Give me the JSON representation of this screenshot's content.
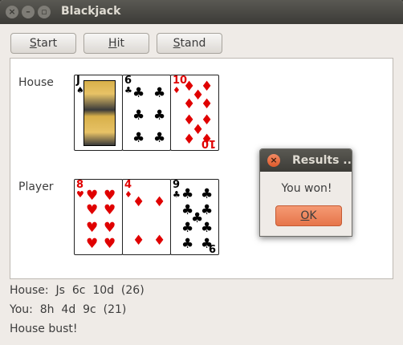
{
  "window": {
    "title": "Blackjack",
    "close_glyph": "×",
    "min_glyph": "–",
    "max_glyph": "▫"
  },
  "toolbar": {
    "start": {
      "mnemonic": "S",
      "rest": "tart"
    },
    "hit": {
      "mnemonic": "H",
      "rest": "it"
    },
    "stand": {
      "mnemonic": "S",
      "rest": "tand"
    }
  },
  "table": {
    "house_label": "House",
    "player_label": "Player",
    "house_cards": [
      {
        "rank": "J",
        "suit": "♠",
        "color": "#000000",
        "face": "jack"
      },
      {
        "rank": "6",
        "suit": "♣",
        "color": "#000000"
      },
      {
        "rank": "10",
        "suit": "♦",
        "color": "#e00000"
      }
    ],
    "player_cards": [
      {
        "rank": "8",
        "suit": "♥",
        "color": "#e00000"
      },
      {
        "rank": "4",
        "suit": "♦",
        "color": "#e00000"
      },
      {
        "rank": "9",
        "suit": "♣",
        "color": "#000000"
      }
    ]
  },
  "status": {
    "house_line": "House:  Js  6c  10d  (26)",
    "player_line": "You:  8h  4d  9c  (21)",
    "result_line": "House bust!"
  },
  "dialog": {
    "title": "Results ..",
    "message": "You won!",
    "ok": {
      "mnemonic": "O",
      "rest": "K"
    },
    "close_glyph": "×",
    "accent_color": "#e6754a"
  }
}
